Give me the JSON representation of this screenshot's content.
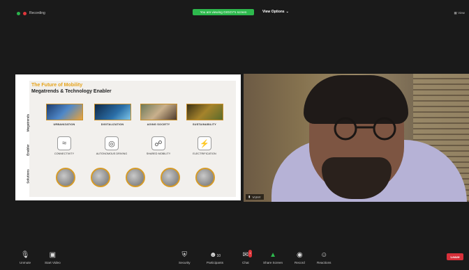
{
  "top": {
    "recording_label": "Recording",
    "sharing_banner": "You are viewing GIGGY's screen",
    "view_options_label": "View Options",
    "view_label": "View"
  },
  "slide": {
    "title": "The Future of Mobility",
    "subtitle": "Megatrends & Technology Enabler",
    "row_labels": [
      "Megatrends",
      "Enabler",
      "Solutions"
    ],
    "megatrends": [
      "URBANIZATION",
      "DIGITALIZATION",
      "AGING SOCIETY",
      "SUSTAINABILITY"
    ],
    "enablers": [
      "CONNECTIVITY",
      "AUTONOMOUS DRIVING",
      "SHARED MOBILITY",
      "ELECTRIFICATION"
    ],
    "solutions_count": 5
  },
  "video": {
    "participant_name": "VIJAY"
  },
  "toolbar": {
    "unmute": "Unmute",
    "start_video": "Start Video",
    "security": "Security",
    "participants": "Participants",
    "participants_count": "10",
    "chat": "Chat",
    "chat_badge": "1",
    "share_screen": "Share Screen",
    "record": "Record",
    "reactions": "Reactions",
    "leave": "Leave"
  },
  "colors": {
    "background": "#1a1a1a",
    "share_green": "#2db94d",
    "leave_red": "#d8303a",
    "slide_accent": "#e6a31a"
  }
}
